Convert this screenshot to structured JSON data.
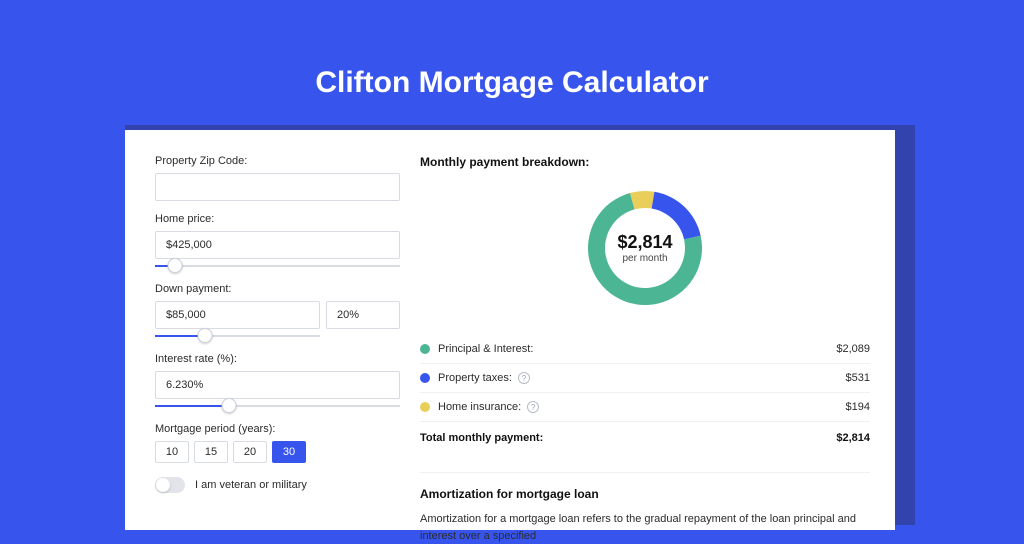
{
  "title": "Clifton Mortgage Calculator",
  "form": {
    "zip": {
      "label": "Property Zip Code:",
      "value": ""
    },
    "price": {
      "label": "Home price:",
      "value": "$425,000",
      "slider_pct": 8
    },
    "down": {
      "label": "Down payment:",
      "amount": "$85,000",
      "pct": "20%",
      "slider_pct": 30
    },
    "rate": {
      "label": "Interest rate (%):",
      "value": "6.230%",
      "slider_pct": 30
    },
    "period": {
      "label": "Mortgage period (years):",
      "options": [
        "10",
        "15",
        "20",
        "30"
      ],
      "selected": "30"
    },
    "veteran": {
      "label": "I am veteran or military",
      "on": false
    }
  },
  "breakdown": {
    "title": "Monthly payment breakdown:",
    "donut": {
      "amount": "$2,814",
      "sub": "per month"
    },
    "rows": [
      {
        "key": "pi",
        "color": "green",
        "label": "Principal & Interest:",
        "value": "$2,089"
      },
      {
        "key": "tax",
        "color": "blue",
        "label": "Property taxes:",
        "value": "$531",
        "help": true
      },
      {
        "key": "ins",
        "color": "yellow",
        "label": "Home insurance:",
        "value": "$194",
        "help": true
      }
    ],
    "total": {
      "label": "Total monthly payment:",
      "value": "$2,814"
    }
  },
  "amort": {
    "title": "Amortization for mortgage loan",
    "text": "Amortization for a mortgage loan refers to the gradual repayment of the loan principal and interest over a specified"
  },
  "chart_data": {
    "type": "pie",
    "title": "Monthly payment breakdown",
    "center_label": "$2,814 per month",
    "series": [
      {
        "name": "Principal & Interest",
        "value": 2089,
        "color": "#4bb594"
      },
      {
        "name": "Property taxes",
        "value": 531,
        "color": "#3755ed"
      },
      {
        "name": "Home insurance",
        "value": 194,
        "color": "#e9ce5a"
      }
    ],
    "total": 2814
  }
}
